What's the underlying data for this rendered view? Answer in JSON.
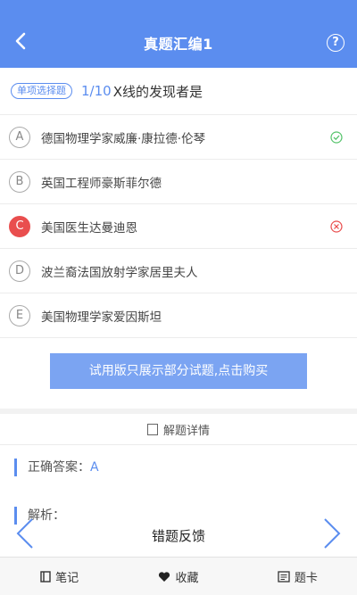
{
  "header": {
    "title": "真题汇编1",
    "help": "?"
  },
  "question": {
    "type": "单项选择题",
    "number": "1/10",
    "text": "X线的发现者是"
  },
  "options": [
    {
      "letter": "A",
      "text": "德国物理学家威廉·康拉德·伦琴",
      "status": "correct"
    },
    {
      "letter": "B",
      "text": "英国工程师豪斯菲尔德",
      "status": ""
    },
    {
      "letter": "C",
      "text": "美国医生达曼迪恩",
      "status": "wrong"
    },
    {
      "letter": "D",
      "text": "波兰裔法国放射学家居里夫人",
      "status": ""
    },
    {
      "letter": "E",
      "text": "美国物理学家爱因斯坦",
      "status": ""
    }
  ],
  "trial_button": "试用版只展示部分试题,点击购买",
  "detail_title": "解题详情",
  "answer": {
    "label": "正确答案：",
    "value": "A"
  },
  "analysis": {
    "label": "解析："
  },
  "feedback": "错题反馈",
  "bottom_bar": {
    "notes": "笔记",
    "favorite": "收藏",
    "card": "题卡"
  },
  "colors": {
    "accent": "#5b8def",
    "wrong": "#e94e4e",
    "correct": "#55c36b"
  }
}
